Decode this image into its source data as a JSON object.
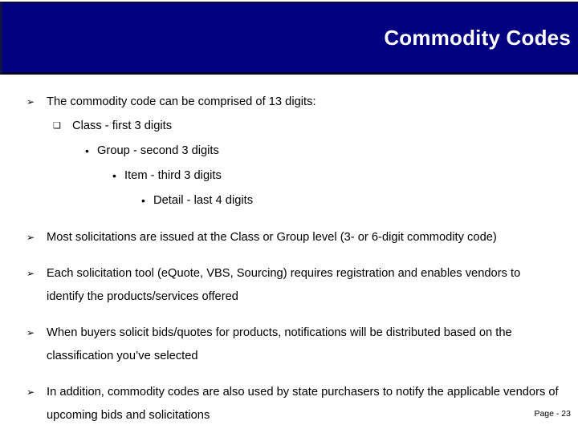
{
  "slide": {
    "title": "Commodity Codes",
    "banner_color": "#000080",
    "title_color": "#FFFFFF",
    "body_text_color": "#000000",
    "background_color": "#FFFFFF"
  },
  "markers": {
    "level1": "➢",
    "level2": "❑",
    "level3": "•",
    "level4": "•",
    "level5": "•"
  },
  "bullets": [
    {
      "level": 1,
      "text": "The commodity code can be comprised of 13 digits:"
    },
    {
      "level": 2,
      "text": "Class - first 3 digits"
    },
    {
      "level": 3,
      "text": "Group - second 3 digits"
    },
    {
      "level": 4,
      "text": "Item - third 3 digits"
    },
    {
      "level": 5,
      "text": "Detail - last 4 digits"
    },
    {
      "level": 1,
      "text": "Most solicitations are issued at the Class or Group level (3- or 6-digit commodity code)"
    },
    {
      "level": 1,
      "text": "Each solicitation tool (eQuote, VBS, Sourcing) requires registration and enables vendors to identify the products/services offered"
    },
    {
      "level": 1,
      "text": "When buyers solicit bids/quotes for products, notifications will be distributed based on the classification you’ve selected"
    },
    {
      "level": 1,
      "text": "In addition, commodity codes are also used by state purchasers to notify the applicable vendors of upcoming bids and solicitations"
    }
  ],
  "footer": {
    "page_label": "Page - 23"
  }
}
